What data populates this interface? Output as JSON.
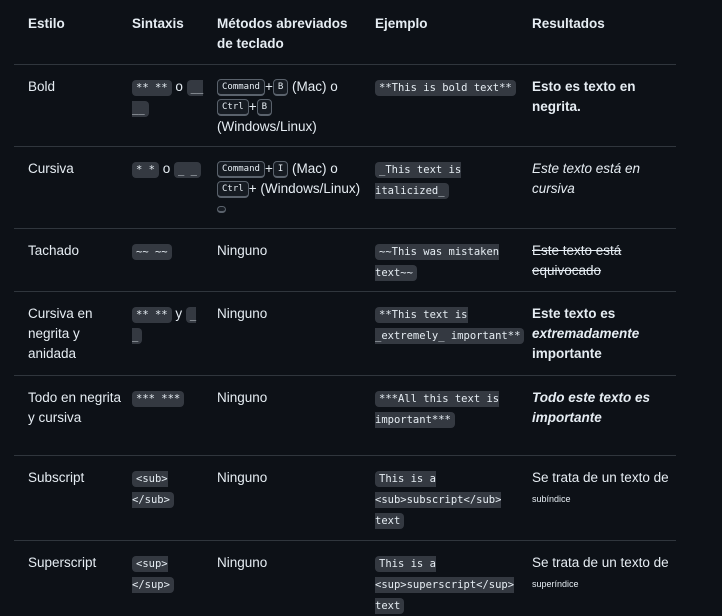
{
  "headers": {
    "style": "Estilo",
    "syntax": "Sintaxis",
    "shortcuts": "Métodos abreviados de teclado",
    "example": "Ejemplo",
    "result": "Resultados"
  },
  "rows": [
    {
      "style": "Bold",
      "syntax": [
        "** **",
        "o",
        "__ __"
      ],
      "sc_a": "Command",
      "sc_b": "B",
      "sc_mac": "(Mac) o",
      "sc_c": "Ctrl",
      "sc_d": "B",
      "sc_tail": "(Windows/Linux)",
      "example": "**This is bold text**",
      "result": "Esto es texto en negrita."
    },
    {
      "style": "Cursiva",
      "syntax": [
        "* *",
        "o",
        "_ _"
      ],
      "sc_a": "Command",
      "sc_b": "I",
      "sc_mac": "(Mac) o",
      "sc_c": "Ctrl",
      "sc_tail": "(Windows/Linux)",
      "example": "_This text is italicized_",
      "result": "Este texto está en cursiva"
    },
    {
      "style": "Tachado",
      "syntax": "~~ ~~",
      "shortcuts": "Ninguno",
      "example": "~~This was mistaken text~~",
      "result": "Este texto está equivocado"
    },
    {
      "style": "Cursiva en negrita y anidada",
      "syntax": [
        "** **",
        "y",
        "_ _"
      ],
      "shortcuts": "Ninguno",
      "example": "**This text is _extremely_ important**",
      "result": [
        "Este texto es",
        "extremadamente",
        "importante"
      ]
    },
    {
      "style": "Todo en negrita y cursiva",
      "syntax": "*** ***",
      "shortcuts": "Ninguno",
      "example": "***All this text is important***",
      "result": "Todo este texto es importante"
    },
    {
      "style": "Subscript",
      "syntax": "<sub> </sub>",
      "shortcuts": "Ninguno",
      "example": "This is a <sub>subscript</sub> text",
      "result": [
        "Se trata de un texto de",
        "subíndice"
      ]
    },
    {
      "style": "Superscript",
      "syntax": "<sup> </sup>",
      "shortcuts": "Ninguno",
      "example": "This is a <sup>superscript</sup> text",
      "result": [
        "Se trata de un texto de",
        "superíndice"
      ]
    }
  ]
}
